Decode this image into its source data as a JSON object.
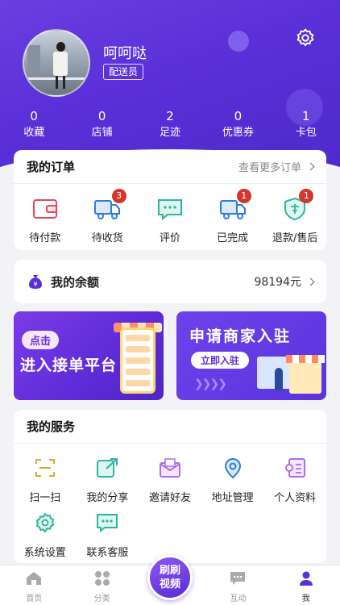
{
  "profile": {
    "name": "呵呵哒",
    "role": "配送员"
  },
  "stats": [
    {
      "value": "0",
      "label": "收藏"
    },
    {
      "value": "0",
      "label": "店铺"
    },
    {
      "value": "2",
      "label": "足迹"
    },
    {
      "value": "0",
      "label": "优惠券"
    },
    {
      "value": "1",
      "label": "卡包"
    }
  ],
  "orders": {
    "title": "我的订单",
    "more": "查看更多订单",
    "items": [
      {
        "label": "待付款",
        "icon": "wallet-icon",
        "badge": null
      },
      {
        "label": "待收货",
        "icon": "truck-icon",
        "badge": "3"
      },
      {
        "label": "评价",
        "icon": "comment-icon",
        "badge": null
      },
      {
        "label": "已完成",
        "icon": "truck-done-icon",
        "badge": "1"
      },
      {
        "label": "退款/售后",
        "icon": "shield-sale-icon",
        "badge": "1"
      }
    ]
  },
  "balance": {
    "title": "我的余额",
    "value": "98194元"
  },
  "banners": {
    "left": {
      "pill": "点击",
      "text": "进入接单平台"
    },
    "right": {
      "text": "申请商家入驻",
      "button": "立即入驻"
    }
  },
  "services": {
    "title": "我的服务",
    "items": [
      {
        "label": "扫一扫",
        "icon": "scan-icon"
      },
      {
        "label": "我的分享",
        "icon": "share-icon"
      },
      {
        "label": "邀请好友",
        "icon": "invite-mail-icon"
      },
      {
        "label": "地址管理",
        "icon": "location-icon"
      },
      {
        "label": "个人资料",
        "icon": "profile-card-icon"
      },
      {
        "label": "系统设置",
        "icon": "settings-icon"
      },
      {
        "label": "联系客服",
        "icon": "chat-service-icon"
      }
    ]
  },
  "tabbar": {
    "items": [
      {
        "label": "首页",
        "icon": "home-icon"
      },
      {
        "label": "分类",
        "icon": "category-icon"
      },
      {
        "label": "",
        "icon": "video-icon"
      },
      {
        "label": "互动",
        "icon": "chat-icon"
      },
      {
        "label": "我",
        "icon": "me-icon"
      }
    ],
    "center": "刷刷视频",
    "active": "我"
  },
  "colors": {
    "brand": "#5a2fd8",
    "badge": "#d3362f",
    "accent_red": "#e8455b",
    "accent_blue": "#2c7be0",
    "accent_teal": "#2bb6a0"
  }
}
